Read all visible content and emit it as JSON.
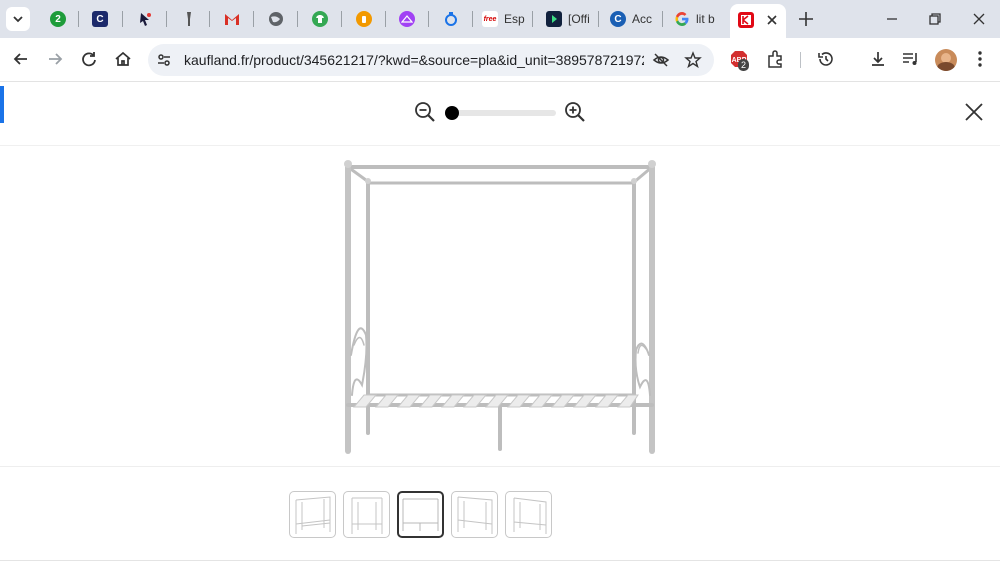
{
  "browser": {
    "tabs": [
      {
        "icon": "green-circle-icon",
        "title": ""
      },
      {
        "icon": "c-logo-icon",
        "title": ""
      },
      {
        "icon": "cursor-star-icon",
        "title": ""
      },
      {
        "icon": "pin-icon",
        "title": ""
      },
      {
        "icon": "gmail-icon",
        "title": ""
      },
      {
        "icon": "globe-icon",
        "title": ""
      },
      {
        "icon": "shirt-icon",
        "title": ""
      },
      {
        "icon": "hand-icon",
        "title": ""
      },
      {
        "icon": "hanger-icon",
        "title": ""
      },
      {
        "icon": "ring-icon",
        "title": ""
      },
      {
        "icon": "free-icon",
        "title": "Esp"
      },
      {
        "icon": "play-icon",
        "title": "[Offi"
      },
      {
        "icon": "c-circle-icon",
        "title": "Acc"
      },
      {
        "icon": "google-icon",
        "title": "lit b"
      },
      {
        "icon": "kaufland-icon",
        "title": ""
      }
    ],
    "url": "kaufland.fr/product/345621217/?kwd=&source=pla&id_unit=389578721972...",
    "extension_badge": "2"
  },
  "viewer": {
    "zoom_level": 0.0,
    "thumbnails": [
      "view-1",
      "view-2",
      "view-3",
      "view-4",
      "view-5"
    ],
    "selected_thumbnail": 2
  },
  "colors": {
    "accent": "#1a73e8",
    "tabstrip": "#dfe3eb"
  }
}
